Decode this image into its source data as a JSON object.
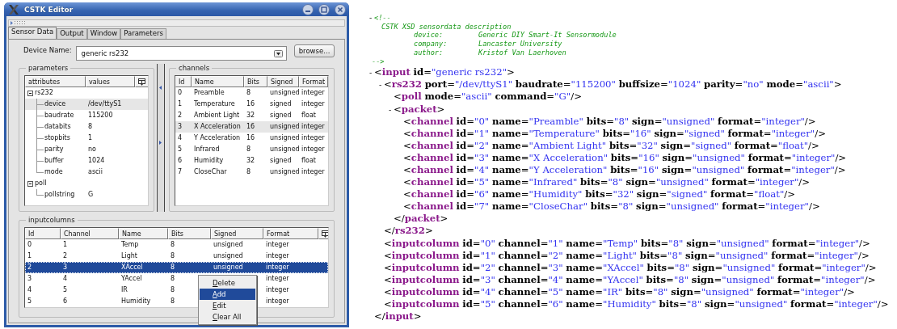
{
  "window": {
    "title": "CSTK Editor",
    "tabs": [
      {
        "label": "Sensor Data",
        "selected": true
      },
      {
        "label": "Output",
        "selected": false
      },
      {
        "label": "Window",
        "selected": false
      },
      {
        "label": "Parameters",
        "selected": false
      }
    ],
    "device_name": {
      "label": "Device Name:",
      "value": "generic rs232"
    },
    "browse_button": "browse...",
    "parameters": {
      "title": "parameters",
      "columns": [
        "attributes",
        "values"
      ],
      "tree": [
        {
          "name": "rs232",
          "expanded": true,
          "selected": false,
          "children": [
            {
              "name": "device",
              "value": "/dev/ttyS1",
              "selected": true
            },
            {
              "name": "baudrate",
              "value": "115200",
              "selected": false
            },
            {
              "name": "databits",
              "value": "8",
              "selected": false
            },
            {
              "name": "stopbits",
              "value": "1",
              "selected": false
            },
            {
              "name": "parity",
              "value": "no",
              "selected": false
            },
            {
              "name": "buffer",
              "value": "1024",
              "selected": false
            },
            {
              "name": "mode",
              "value": "ascii",
              "selected": false
            }
          ]
        },
        {
          "name": "poll",
          "expanded": true,
          "selected": false,
          "children": [
            {
              "name": "pollstring",
              "value": "G",
              "selected": false
            }
          ]
        }
      ]
    },
    "channels": {
      "title": "channels",
      "focused": false,
      "columns": [
        "Id",
        "Name",
        "Bits",
        "Signed",
        "Format"
      ],
      "rows": [
        {
          "cells": [
            "0",
            "Preamble",
            "8",
            "unsigned",
            "integer"
          ],
          "selected": false
        },
        {
          "cells": [
            "1",
            "Temperature",
            "16",
            "signed",
            "integer"
          ],
          "selected": false
        },
        {
          "cells": [
            "2",
            "Ambient Light",
            "32",
            "signed",
            "float"
          ],
          "selected": false
        },
        {
          "cells": [
            "3",
            "X Acceleration",
            "16",
            "unsigned",
            "integer"
          ],
          "selected": true
        },
        {
          "cells": [
            "4",
            "Y Acceleration",
            "16",
            "unsigned",
            "integer"
          ],
          "selected": false
        },
        {
          "cells": [
            "5",
            "Infrared",
            "8",
            "unsigned",
            "integer"
          ],
          "selected": false
        },
        {
          "cells": [
            "6",
            "Humidity",
            "32",
            "signed",
            "float"
          ],
          "selected": false
        },
        {
          "cells": [
            "7",
            "CloseChar",
            "8",
            "unsigned",
            "integer"
          ],
          "selected": false
        }
      ]
    },
    "inputcolumns": {
      "title": "inputcolumns",
      "focused": true,
      "columns": [
        "Id",
        "Channel",
        "Name",
        "Bits",
        "Signed",
        "Format"
      ],
      "rows": [
        {
          "cells": [
            "0",
            "1",
            "Temp",
            "8",
            "unsigned",
            "integer"
          ],
          "selected": false
        },
        {
          "cells": [
            "1",
            "2",
            "Light",
            "8",
            "unsigned",
            "integer"
          ],
          "selected": false
        },
        {
          "cells": [
            "2",
            "3",
            "XAccel",
            "8",
            "unsigned",
            "integer"
          ],
          "selected": true
        },
        {
          "cells": [
            "3",
            "4",
            "YAccel",
            "8",
            "integer"
          ],
          "selected": false
        },
        {
          "cells": [
            "4",
            "5",
            "IR",
            "8",
            "integer"
          ],
          "selected": false
        },
        {
          "cells": [
            "5",
            "6",
            "Humidity",
            "8",
            "integer"
          ],
          "selected": false
        }
      ]
    },
    "context_menu": {
      "items": [
        {
          "label": "Delete",
          "selected": false
        },
        {
          "label": "Add",
          "selected": true
        },
        {
          "label": "Edit",
          "selected": false
        },
        {
          "label": "Clear All",
          "selected": false
        }
      ]
    }
  },
  "xml": {
    "comment": {
      "toggle": "-",
      "open": "<!--",
      "lines": [
        {
          "label": "CSTK XSD sensordata description"
        },
        {
          "label": "device:",
          "value": "Generic DIY Smart-It Sensormodule"
        },
        {
          "label": "company:",
          "value": "Lancaster University"
        },
        {
          "label": "author:",
          "value": "Kristof Van Laerhoven"
        }
      ],
      "close": "-->"
    },
    "root": {
      "toggle": "-",
      "text": "<input id=\"generic rs232\">",
      "close": "</input>",
      "children": [
        {
          "toggle": "-",
          "text": "<rs232 port=\"/dev/ttyS1\" baudrate=\"115200\" buffsize=\"1024\" parity=\"no\" mode=\"ascii\">",
          "close": "</rs232>",
          "children": [
            {
              "text": "<poll mode=\"ascii\" command=\"G\"/>"
            },
            {
              "toggle": "-",
              "text": "<packet>",
              "close": "</packet>",
              "children": [
                {
                  "text": "<channel id=\"0\" name=\"Preamble\" bits=\"8\" sign=\"unsigned\" format=\"integer\"/>"
                },
                {
                  "text": "<channel id=\"1\" name=\"Temperature\" bits=\"16\" sign=\"signed\" format=\"integer\"/>"
                },
                {
                  "text": "<channel id=\"2\" name=\"Ambient Light\" bits=\"32\" sign=\"signed\" format=\"float\"/>"
                },
                {
                  "text": "<channel id=\"3\" name=\"X Acceleration\" bits=\"16\" sign=\"unsigned\" format=\"integer\"/>"
                },
                {
                  "text": "<channel id=\"4\" name=\"Y Acceleration\" bits=\"16\" sign=\"unsigned\" format=\"integer\"/>"
                },
                {
                  "text": "<channel id=\"5\" name=\"Infrared\" bits=\"8\" sign=\"unsigned\" format=\"integer\"/>"
                },
                {
                  "text": "<channel id=\"6\" name=\"Humidity\" bits=\"32\" sign=\"signed\" format=\"float\"/>"
                },
                {
                  "text": "<channel id=\"7\" name=\"CloseChar\" bits=\"8\" sign=\"unsigned\" format=\"integer\"/>"
                }
              ]
            }
          ]
        },
        {
          "text": "<inputcolumn id=\"0\" channel=\"1\" name=\"Temp\" bits=\"8\" sign=\"unsigned\" format=\"integer\"/>"
        },
        {
          "text": "<inputcolumn id=\"1\" channel=\"2\" name=\"Light\" bits=\"8\" sign=\"unsigned\" format=\"integer\"/>"
        },
        {
          "text": "<inputcolumn id=\"2\" channel=\"3\" name=\"XAccel\" bits=\"8\" sign=\"unsigned\" format=\"integer\"/>"
        },
        {
          "text": "<inputcolumn id=\"3\" channel=\"4\" name=\"YAccel\" bits=\"8\" sign=\"unsigned\" format=\"integer\"/>"
        },
        {
          "text": "<inputcolumn id=\"4\" channel=\"5\" name=\"IR\" bits=\"8\" sign=\"unsigned\" format=\"integer\"/>"
        },
        {
          "text": "<inputcolumn id=\"5\" channel=\"6\" name=\"Humidity\" bits=\"8\" sign=\"unsigned\" format=\"integer\"/>"
        }
      ]
    }
  }
}
